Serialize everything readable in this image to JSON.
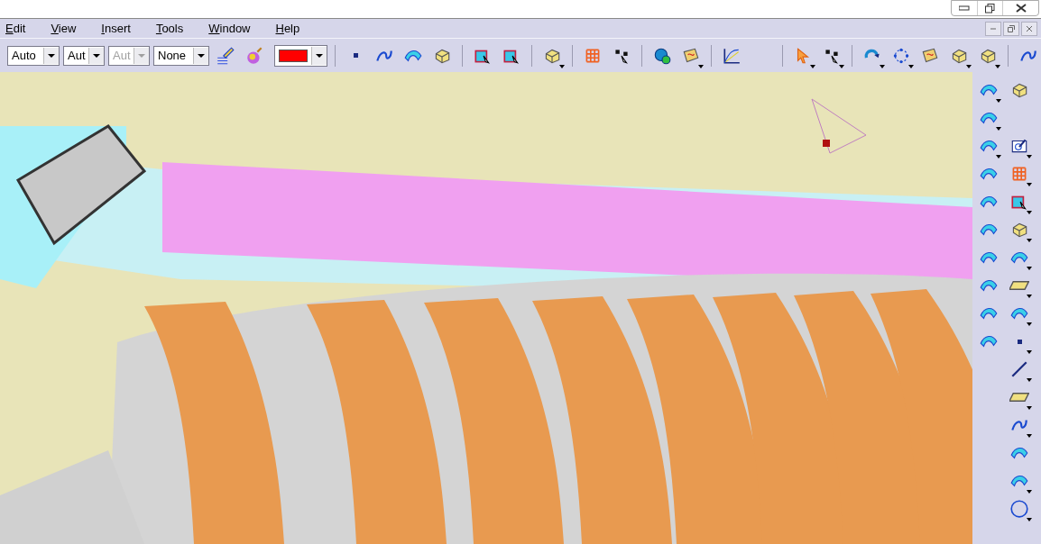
{
  "menu_bar": [
    {
      "label": "Edit"
    },
    {
      "label": "View"
    },
    {
      "label": "Insert"
    },
    {
      "label": "Tools"
    },
    {
      "label": "Window"
    },
    {
      "label": "Help"
    }
  ],
  "toolbar": {
    "dropdowns": [
      {
        "value": "Auto",
        "disabled": false
      },
      {
        "value": "Aut",
        "disabled": false
      },
      {
        "value": "Aut",
        "disabled": true
      },
      {
        "value": "None",
        "disabled": false
      }
    ],
    "color_picker": {
      "color": "#ff0000"
    }
  }
}
